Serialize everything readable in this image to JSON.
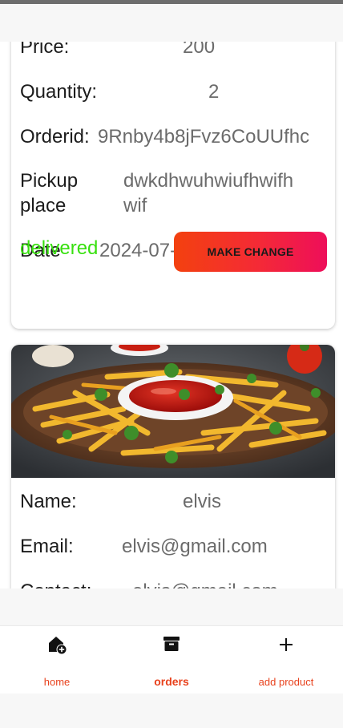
{
  "order_card": {
    "price_label": "Price:",
    "price_value": "200",
    "quantity_label": "Quantity:",
    "quantity_value": "2",
    "orderid_label": "Orderid:",
    "orderid_value": "9Rnby4b8jFvz6CoUUfhc",
    "pickup_label_line1": "Pickup",
    "pickup_label_line2": "place",
    "pickup_value_line1": "dwkdhwuhwiufhwifh",
    "pickup_value_line2": "wif",
    "date_label": "Date",
    "date_value": "2024-07-26 14:11:40",
    "status": "delivered",
    "status_color": "#38e00f",
    "action_label": "MAKE CHANGE"
  },
  "customer_card": {
    "image": "french-fries-with-ketchup-image",
    "name_label": "Name:",
    "name_value": "elvis",
    "email_label": "Email:",
    "email_value": "elvis@gmail.com",
    "contact_label": "Contact:",
    "contact_value": "elvis@gmail.com"
  },
  "bottom_nav": {
    "accent_color": "#e8421d",
    "items": [
      {
        "label": "home",
        "icon": "home-add-icon",
        "active": false
      },
      {
        "label": "orders",
        "icon": "orders-box-icon",
        "active": true
      },
      {
        "label": "add product",
        "icon": "plus-icon",
        "active": false
      }
    ]
  }
}
